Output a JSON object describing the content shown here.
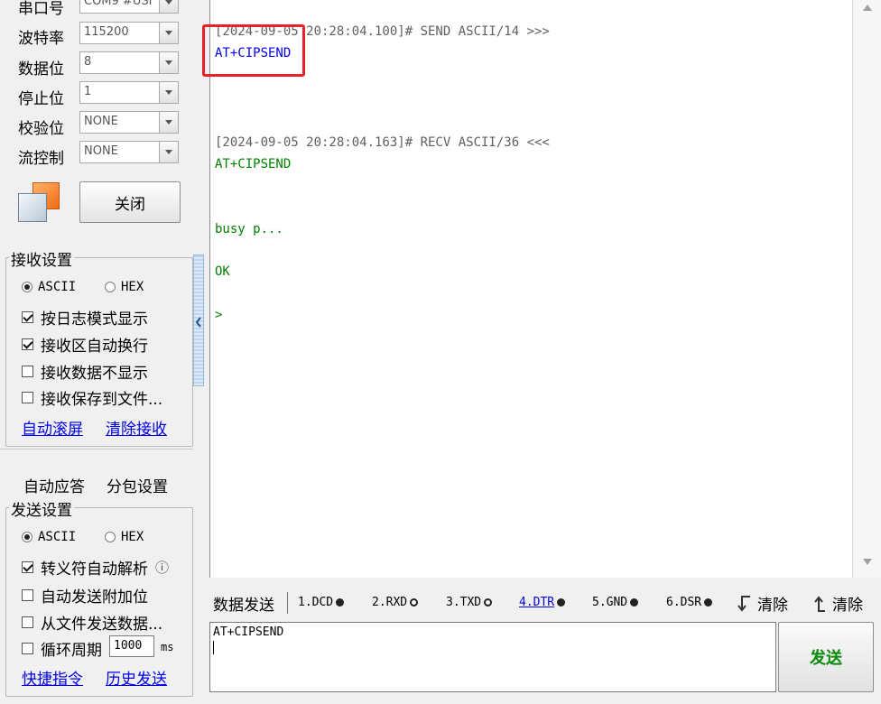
{
  "serial": {
    "rows": [
      {
        "label": "串口号",
        "value": "COM9 #USI"
      },
      {
        "label": "波特率",
        "value": "115200"
      },
      {
        "label": "数据位",
        "value": "8"
      },
      {
        "label": "停止位",
        "value": "1"
      },
      {
        "label": "校验位",
        "value": "NONE"
      },
      {
        "label": "流控制",
        "value": "NONE"
      }
    ],
    "open_button": "关闭"
  },
  "receive": {
    "title": "接收设置",
    "mode_ascii": "ASCII",
    "mode_hex": "HEX",
    "options": [
      "按日志模式显示",
      "接收区自动换行",
      "接收数据不显示",
      "接收保存到文件..."
    ],
    "links": [
      "自动滚屏",
      "清除接收"
    ]
  },
  "tabs": [
    "自动应答",
    "分包设置"
  ],
  "send": {
    "title": "发送设置",
    "mode_ascii": "ASCII",
    "mode_hex": "HEX",
    "options": [
      "转义符自动解析",
      "自动发送附加位",
      "从文件发送数据...",
      "循环周期"
    ],
    "period_value": "1000",
    "period_unit": "ms",
    "links": [
      "快捷指令",
      "历史发送"
    ],
    "info_icon": "ⓘ"
  },
  "log": [
    {
      "type": "hdr",
      "text": "[2024-09-05 20:28:04.100]# SEND ASCII/14 >>>"
    },
    {
      "type": "send",
      "text": "AT+CIPSEND"
    },
    {
      "type": "hdr",
      "text": "[2024-09-05 20:28:04.163]# RECV ASCII/36 <<<"
    },
    {
      "type": "recv",
      "text": "AT+CIPSEND"
    },
    {
      "type": "recv",
      "text": "busy p..."
    },
    {
      "type": "recv",
      "text": "OK"
    },
    {
      "type": "recv",
      "text": ">"
    }
  ],
  "sendbar": {
    "tab_label": "数据发送",
    "signals": [
      "1.DCD",
      "2.RXD",
      "3.TXD",
      "4.DTR",
      "5.GND",
      "6.DSR"
    ],
    "clear1": "清除",
    "clear2": "清除",
    "input_text": "AT+CIPSEND",
    "send_button": "发送"
  },
  "colors": {
    "highlight_box": "#e8202a",
    "send_text": "#0000ee",
    "recv_text": "#008000",
    "send_btn_text": "#0a8a0a"
  }
}
